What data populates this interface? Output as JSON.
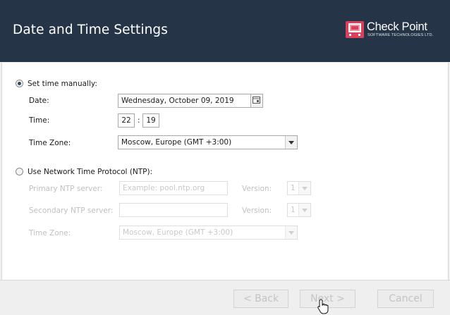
{
  "header": {
    "title": "Date and Time Settings",
    "logo_name": "Check Point",
    "logo_sub": "SOFTWARE TECHNOLOGIES LTD."
  },
  "manual": {
    "radio_label": "Set time manually:",
    "date_label": "Date:",
    "date_value": "Wednesday, October 09, 2019",
    "time_label": "Time:",
    "time_hour": "22",
    "time_separator": ":",
    "time_minute": "19",
    "tz_label": "Time Zone:",
    "tz_value": "Moscow, Europe (GMT +3:00)"
  },
  "ntp": {
    "radio_label": "Use Network Time Protocol (NTP):",
    "primary_label": "Primary NTP server:",
    "primary_placeholder": "Example: pool.ntp.org",
    "primary_version_label": "Version:",
    "primary_version_value": "1",
    "secondary_label": "Secondary NTP server:",
    "secondary_version_label": "Version:",
    "secondary_version_value": "1",
    "tz_label": "Time Zone:",
    "tz_value": "Moscow, Europe (GMT +3:00)"
  },
  "footer": {
    "back_label": "< Back",
    "next_label": "Next >",
    "cancel_label": "Cancel"
  },
  "colors": {
    "header_bg": "#253447",
    "logo_red": "#d9415a",
    "disabled_text": "#c0c0c0"
  }
}
